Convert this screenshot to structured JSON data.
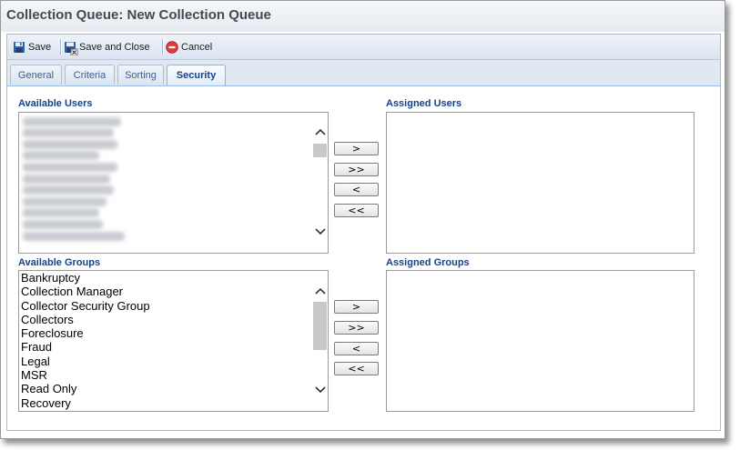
{
  "window": {
    "title": "Collection Queue: New Collection Queue"
  },
  "toolbar": {
    "save_label": "Save",
    "save_close_label": "Save and Close",
    "cancel_label": "Cancel"
  },
  "tabs": [
    {
      "label": "General",
      "active": false
    },
    {
      "label": "Criteria",
      "active": false
    },
    {
      "label": "Sorting",
      "active": false
    },
    {
      "label": "Security",
      "active": true
    }
  ],
  "security": {
    "available_users_label": "Available Users",
    "assigned_users_label": "Assigned Users",
    "available_groups_label": "Available Groups",
    "assigned_groups_label": "Assigned Groups",
    "available_groups": [
      "Bankruptcy",
      "Collection Manager",
      "Collector Security Group",
      "Collectors",
      "Foreclosure",
      "Fraud",
      "Legal",
      "MSR",
      "Read Only",
      "Recovery"
    ],
    "move_buttons": {
      "add_selected": ">",
      "add_all": ">>",
      "remove_selected": "<",
      "remove_all": "<<"
    }
  },
  "colors": {
    "label_blue": "#15428b",
    "cancel_red": "#e03a3a",
    "save_blue": "#2f5fa8"
  }
}
